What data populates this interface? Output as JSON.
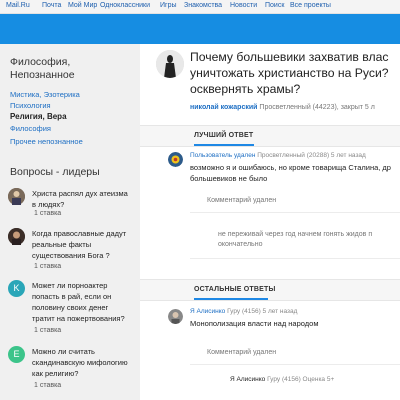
{
  "topnav": [
    "Mail.Ru",
    "Почта",
    "Мой Мир",
    "Одноклассники",
    "Игры",
    "Знакомства",
    "Новости",
    "Поиск",
    "Все проекты"
  ],
  "sidebar": {
    "category_title": [
      "Философия,",
      "Непознанное"
    ],
    "links": [
      "Мистика, Эзотерика",
      "Психология",
      "Религия, Вера",
      "Философия",
      "Прочее непознанное"
    ],
    "leaders_title": "Вопросы - лидеры",
    "leaders": [
      {
        "lines": [
          "Христа распял дух атеизма",
          "в людях?"
        ],
        "stake": "1 ставка"
      },
      {
        "lines": [
          "Когда православные дадут",
          "реальные факты",
          "существования Бога ?"
        ],
        "stake": "1 ставка"
      },
      {
        "letter": "K",
        "lines": [
          "Может ли порноактер",
          "попасть в рай, если он",
          "половину своих денег",
          "тратит на пожертвования?"
        ],
        "stake": "1 ставка"
      },
      {
        "letter": "E",
        "lines": [
          "Можно ли считать",
          "скандинавскую мифологию",
          "как религию?"
        ],
        "stake": "1 ставка"
      }
    ]
  },
  "question": {
    "title_lines": [
      "Почему большевики захватив влас",
      "уничтожать христианство на Руси?",
      "осквернять храмы?"
    ],
    "author": "николай кожарский",
    "author_meta": "Просветленный (44223), закрыт 5 л"
  },
  "best": {
    "label": "ЛУЧШИЙ ОТВЕТ",
    "author": "Пользователь удален",
    "meta": "Просветленный (20288) 5 лет назад",
    "text_lines": [
      "возможно я и ошибаюсь, но кроме товарища Сталина, др",
      "большевиков не было"
    ],
    "comment_deleted": "Комментарий удален",
    "reply_lines": [
      "не переживай через год начнем гонять жидов п",
      "окончательно"
    ]
  },
  "others": {
    "label": "ОСТАЛЬНЫЕ ОТВЕТЫ",
    "answer1": {
      "author": "Я Алисинко",
      "meta": "Гуру (4156) 5 лет назад",
      "text": "Монополизация власти над народом"
    },
    "comment_deleted": "Комментарий удален",
    "answer2": {
      "author": "Я Алисинко",
      "meta": "Гуру (4156) Оценка 5+"
    }
  }
}
